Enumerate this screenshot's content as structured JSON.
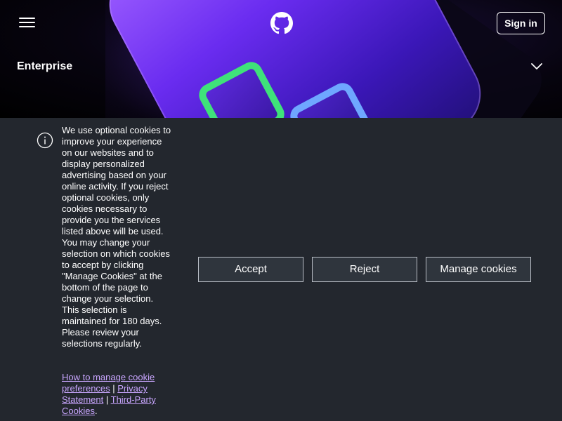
{
  "header": {
    "signin_label": "Sign in",
    "section_title": "Enterprise"
  },
  "icons": {
    "menu": "hamburger-menu-icon",
    "logo": "github-logo-icon",
    "chevron": "chevron-down-icon",
    "info": "info-circle-icon"
  },
  "cookie_banner": {
    "message": "We use optional cookies to improve your experience on our websites and to display personalized advertising based on your online activity. If you reject optional cookies, only cookies necessary to provide you the services listed above will be used. You may change your selection on which cookies to accept by clicking \"Manage Cookies\" at the bottom of the page to change your selection. This selection is maintained for 180 days. Please review your selections regularly.",
    "links": {
      "manage_preferences": "How to manage cookie preferences",
      "separator": " | ",
      "privacy_statement": "Privacy Statement",
      "third_party_cookies": "Third-Party Cookies",
      "end_punctuation": "."
    },
    "buttons": {
      "accept": "Accept",
      "reject": "Reject",
      "manage": "Manage cookies"
    }
  },
  "colors": {
    "banner_background": "#23272e",
    "button_background": "#2f353d",
    "link": "#c9a6ff",
    "hero_purple": "#6a2cf0",
    "key_green": "#3fe27a",
    "key_blue": "#6fa7ff"
  }
}
